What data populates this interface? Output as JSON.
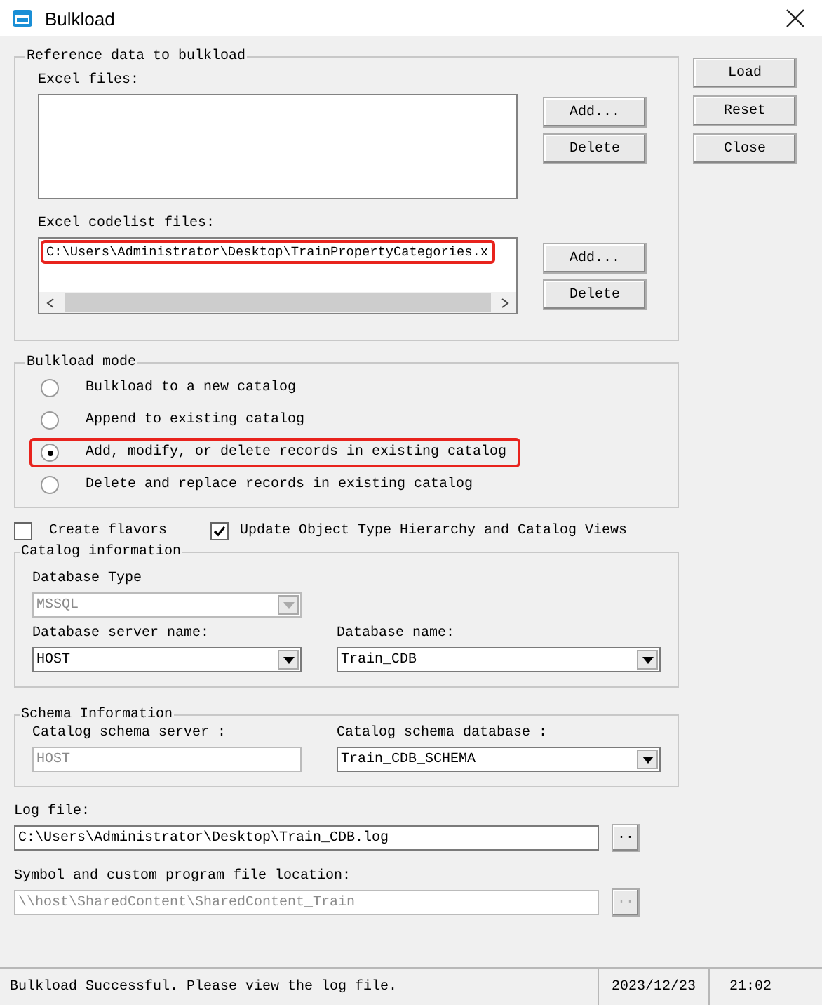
{
  "window": {
    "title": "Bulkload"
  },
  "side_buttons": [
    {
      "label": "Load"
    },
    {
      "label": "Reset"
    },
    {
      "label": "Close"
    }
  ],
  "reference_group": {
    "title": "Reference data to bulkload",
    "excel_files": {
      "label": "Excel files:",
      "buttons": [
        "Add...",
        "Delete"
      ]
    },
    "codelist_files": {
      "label": "Excel codelist files:",
      "items": [
        {
          "text": "C:\\Users\\Administrator\\Desktop\\TrainPropertyCategories.x",
          "highlighted": true
        }
      ],
      "buttons": [
        "Add...",
        "Delete"
      ]
    }
  },
  "mode_group": {
    "title": "Bulkload mode",
    "options": [
      {
        "label": "Bulkload to a new catalog",
        "selected": false,
        "highlighted": false
      },
      {
        "label": "Append to existing  catalog",
        "selected": false,
        "highlighted": false
      },
      {
        "label": "Add, modify, or delete records in existing catalog",
        "selected": true,
        "highlighted": true
      },
      {
        "label": "Delete and replace records in existing catalog",
        "selected": false,
        "highlighted": false
      }
    ]
  },
  "checkboxes": [
    {
      "label": "Create flavors",
      "checked": false
    },
    {
      "label": "Update Object Type Hierarchy and Catalog Views",
      "checked": true
    }
  ],
  "catalog_group": {
    "title": "Catalog information",
    "database_type": {
      "label": "Database Type",
      "value": "MSSQL",
      "disabled": true
    },
    "server": {
      "label": "Database server name:",
      "value": "HOST",
      "disabled": false
    },
    "database": {
      "label": "Database name:",
      "value": "Train_CDB",
      "disabled": false
    }
  },
  "schema_group": {
    "title": "Schema Information",
    "server": {
      "label": "Catalog schema server :",
      "value": "HOST",
      "disabled": true
    },
    "database": {
      "label": "Catalog schema database :",
      "value": "Train_CDB_SCHEMA",
      "disabled": false
    }
  },
  "log_file": {
    "label": "Log file:",
    "value": "C:\\Users\\Administrator\\Desktop\\Train_CDB.log",
    "disabled": false,
    "browse": "··"
  },
  "symbol_location": {
    "label": "Symbol and custom program file location:",
    "value": "\\\\host\\SharedContent\\SharedContent_Train",
    "disabled": true,
    "browse": "··"
  },
  "status_bar": {
    "message": "Bulkload Successful. Please view the log file.",
    "date": "2023/12/23",
    "time": "21:02"
  }
}
